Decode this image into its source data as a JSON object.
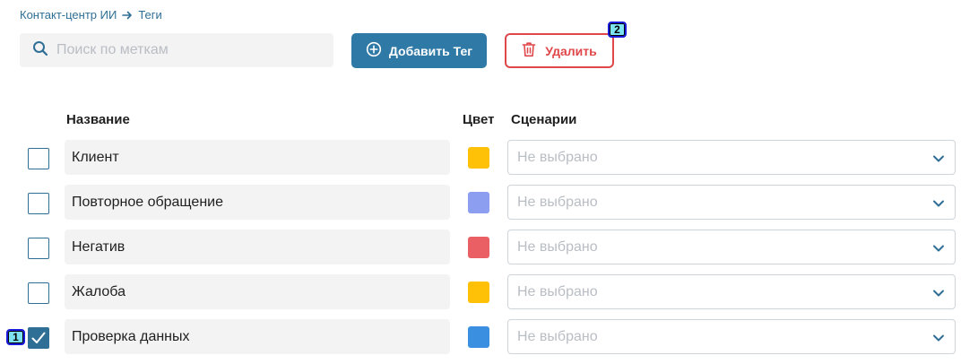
{
  "breadcrumb": {
    "parent": "Контакт-центр ИИ",
    "current": "Теги"
  },
  "search": {
    "placeholder": "Поиск по меткам",
    "value": ""
  },
  "toolbar": {
    "add_label": "Добавить Тег",
    "delete_label": "Удалить"
  },
  "table": {
    "headers": {
      "name": "Название",
      "color": "Цвет",
      "scenarios": "Сценарии"
    },
    "rows": [
      {
        "name": "Клиент",
        "color": "#ffc107",
        "scenario": "Не выбрано",
        "checked": false
      },
      {
        "name": "Повторное обращение",
        "color": "#8c9ef0",
        "scenario": "Не выбрано",
        "checked": false
      },
      {
        "name": "Негатив",
        "color": "#ea5f63",
        "scenario": "Не выбрано",
        "checked": false
      },
      {
        "name": "Жалоба",
        "color": "#ffc107",
        "scenario": "Не выбрано",
        "checked": false
      },
      {
        "name": "Проверка данных",
        "color": "#3a8fe0",
        "scenario": "Не выбрано",
        "checked": true
      }
    ]
  },
  "annotations": {
    "marker_1": "1",
    "marker_2": "2"
  },
  "theme": {
    "accent": "#2f79a6",
    "danger": "#e0474a",
    "link": "#2f6f96"
  }
}
